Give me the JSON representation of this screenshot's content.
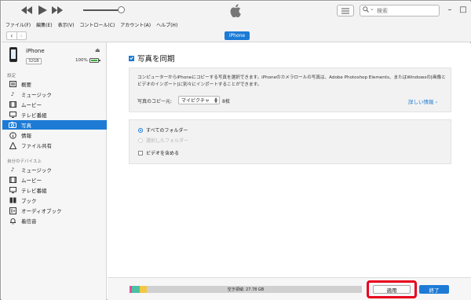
{
  "toolbar": {
    "search_placeholder": "検索",
    "volume_level": 0.95
  },
  "menu": [
    "ファイル(F)",
    "編集(E)",
    "表示(V)",
    "コントロール(C)",
    "アカウント(A)",
    "ヘルプ(H)"
  ],
  "nav": {
    "device_label": "iPhone"
  },
  "device": {
    "name": "iPhone",
    "capacity": "32GB",
    "battery": "100%"
  },
  "sidebar": {
    "settings_header": "設定",
    "settings_items": [
      {
        "label": "概要",
        "icon": "summary-icon"
      },
      {
        "label": "ミュージック",
        "icon": "music-icon"
      },
      {
        "label": "ムービー",
        "icon": "movie-icon"
      },
      {
        "label": "テレビ番組",
        "icon": "tv-icon"
      },
      {
        "label": "写真",
        "icon": "camera-icon"
      },
      {
        "label": "情報",
        "icon": "info-icon"
      },
      {
        "label": "ファイル共有",
        "icon": "apps-icon"
      }
    ],
    "ondevice_header": "自分のデバイス上",
    "ondevice_items": [
      {
        "label": "ミュージック",
        "icon": "music-icon"
      },
      {
        "label": "ムービー",
        "icon": "movie-icon"
      },
      {
        "label": "テレビ番組",
        "icon": "tv-icon"
      },
      {
        "label": "ブック",
        "icon": "book-icon"
      },
      {
        "label": "オーディオブック",
        "icon": "audiobook-icon"
      },
      {
        "label": "着信音",
        "icon": "bell-icon"
      }
    ]
  },
  "photos": {
    "sync_title": "写真を同期",
    "description": "コンピューターからiPhoneにコピーする写真を選択できます。iPhoneのカメラロールの写真は、Adobe Photoshop Elements、またはWindowsの[画像とビデオのインポート]に別々にインポートすることができます。",
    "copy_label": "写真のコピー元:",
    "source_value": "マイピクチャ",
    "count": "8枚",
    "details_link": "詳しい情報",
    "options": {
      "all_folders": "すべてのフォルダー",
      "selected_folders": "選択したフォルダー",
      "include_videos": "ビデオを含める"
    }
  },
  "footer": {
    "storage_text": "空き領域: 27.78 GB",
    "apply_label": "適用",
    "done_label": "終了"
  }
}
